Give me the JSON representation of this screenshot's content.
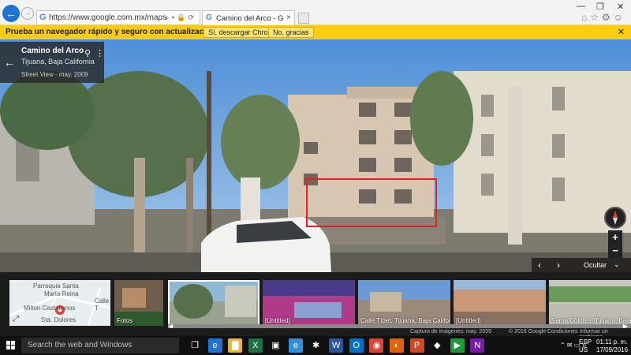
{
  "browser": {
    "url": "https://www.google.com.mx/maps/place/Camino+",
    "tab_title": "Camino del Arco - Google ...",
    "tab_close": "×",
    "back": "←",
    "forward": "→",
    "window_controls": [
      "—",
      "❐",
      "✕"
    ],
    "toolbar_icons": [
      "⌂",
      "☆",
      "⚙",
      "☺"
    ]
  },
  "infobar": {
    "message": "Prueba un navegador rápido y seguro con actualizaciones automáticas",
    "accept_label": "Sí, descargar Chrome",
    "decline_label": "No, gracias",
    "close": "✕"
  },
  "place_card": {
    "name": "Camino del Arco",
    "location": "Tijuana, Baja California",
    "date": "Street View - may. 2009",
    "back": "←",
    "pin": "⚲",
    "more": "⋮"
  },
  "controls": {
    "zoom_in": "+",
    "zoom_out": "−",
    "prev": "‹",
    "next": "›",
    "hide_label": "Ocultar",
    "hide_chevron": "⌄"
  },
  "filmstrip": {
    "map": {
      "labels": [
        "Parroquia Santa",
        "María Reina",
        "Calle T",
        "Sta. Dolores",
        "Milton Castellanos"
      ],
      "expand": "⤢"
    },
    "thumbs": [
      {
        "caption": "Fotos",
        "colors": [
          "#b98b66",
          "#6f5e4b",
          "#2e5a2e"
        ]
      },
      {
        "caption": "",
        "colors": [
          "#8fb7d6",
          "#9aa18e",
          "#c9c9bd"
        ]
      },
      {
        "caption": "[Untitled]",
        "colors": [
          "#4a3a8a",
          "#b03a8a",
          "#8aa0d0"
        ]
      },
      {
        "caption": "Calle Tíbet, Tijuana, Baja California",
        "colors": [
          "#6a9ad8",
          "#c8b8a0",
          "#9a8a7a"
        ]
      },
      {
        "caption": "[Untitled]",
        "colors": [
          "#9ab8d8",
          "#c89878",
          "#8a7060"
        ]
      },
      {
        "caption": "Santa Dolores, Tijuana, Baja Californ",
        "colors": [
          "#c8c8c0",
          "#6a9a5a",
          "#bbbbb0"
        ]
      }
    ],
    "scroll_left": "◀",
    "scroll_right": "▶"
  },
  "footer": {
    "imagery": "Captura de imágenes: may. 2009",
    "copyright": "© 2016 Google",
    "conditions": "Condiciones",
    "report": "Informar un problema"
  },
  "taskbar": {
    "search_placeholder": "Search the web and Windows",
    "apps": [
      {
        "icon": "task-view-icon",
        "glyph": "❐",
        "color": "#101010"
      },
      {
        "icon": "edge-icon",
        "glyph": "e",
        "color": "#1e73d4"
      },
      {
        "icon": "file-explorer-icon",
        "glyph": "▇",
        "color": "#e8b830"
      },
      {
        "icon": "excel-icon",
        "glyph": "X",
        "color": "#1e7145"
      },
      {
        "icon": "store-icon",
        "glyph": "▣",
        "color": "#101010"
      },
      {
        "icon": "internet-explorer-icon",
        "glyph": "e",
        "color": "#2f8fe0"
      },
      {
        "icon": "app-icon",
        "glyph": "✱",
        "color": "#101010"
      },
      {
        "icon": "word-icon",
        "glyph": "W",
        "color": "#2b579a"
      },
      {
        "icon": "outlook-icon",
        "glyph": "O",
        "color": "#0072c6"
      },
      {
        "icon": "chrome-icon",
        "glyph": "◉",
        "color": "#db4437"
      },
      {
        "icon": "firefox-icon",
        "glyph": "◐",
        "color": "#e66000"
      },
      {
        "icon": "powerpoint-icon",
        "glyph": "P",
        "color": "#d24726"
      },
      {
        "icon": "photos-icon",
        "glyph": "◆",
        "color": "#101010"
      },
      {
        "icon": "media-icon",
        "glyph": "▶",
        "color": "#1a9a3a"
      },
      {
        "icon": "onenote-icon",
        "glyph": "N",
        "color": "#7719aa"
      }
    ],
    "tray_icons": "⌃ ✉ ▭ ))",
    "lang_top": "ESP",
    "lang_bottom": "US",
    "time": "01:11 p. m.",
    "date": "17/09/2016"
  }
}
